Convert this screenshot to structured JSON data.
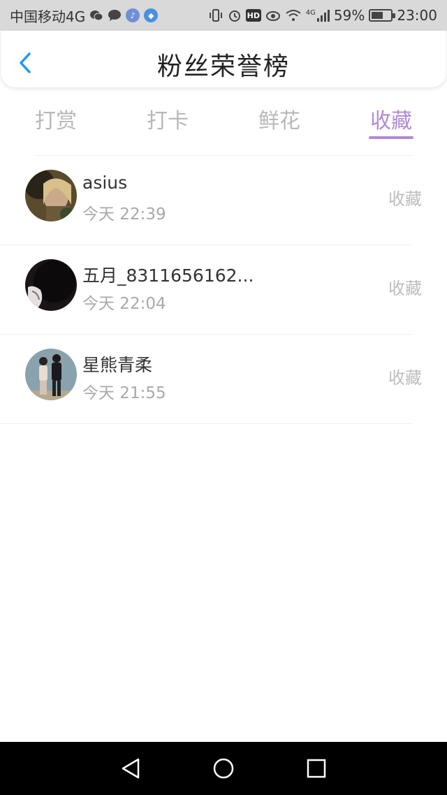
{
  "status_bar": {
    "carrier": "中国移动4G",
    "battery_text": "59%",
    "battery_level": 0.59,
    "time": "23:00",
    "network_badge": "4G",
    "hd_badge": "HD",
    "icons_left": [
      "wechat-icon",
      "message-icon",
      "music-icon",
      "browser-icon"
    ],
    "icons_right": [
      "vibrate-icon",
      "alarm-icon",
      "hd-icon",
      "eye-icon",
      "wifi-icon",
      "signal-icon",
      "battery-icon"
    ]
  },
  "header": {
    "title": "粉丝荣誉榜",
    "back_icon": "chevron-left-icon",
    "accent": "#2196f3"
  },
  "tabs": [
    {
      "label": "打赏",
      "active": false
    },
    {
      "label": "打卡",
      "active": false
    },
    {
      "label": "鲜花",
      "active": false
    },
    {
      "label": "收藏",
      "active": true
    }
  ],
  "accent_color": "#b18ad6",
  "list": [
    {
      "name": "asius",
      "time": "今天 22:39",
      "action": "收藏"
    },
    {
      "name": "五月_8311656162...",
      "time": "今天 22:04",
      "action": "收藏"
    },
    {
      "name": "星熊青柔",
      "time": "今天 21:55",
      "action": "收藏"
    }
  ],
  "nav_bar": {
    "icons": [
      "back-triangle-icon",
      "home-circle-icon",
      "recents-square-icon"
    ]
  }
}
